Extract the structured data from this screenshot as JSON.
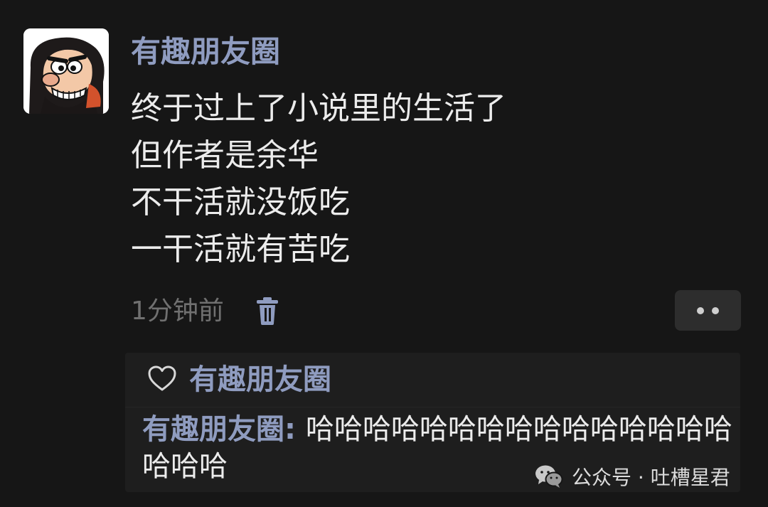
{
  "post": {
    "author": "有趣朋友圈",
    "content_lines": [
      "终于过上了小说里的生活了",
      "但作者是余华",
      "不干活就没饭吃",
      "一干活就有苦吃"
    ],
    "time": "1分钟前"
  },
  "icons": {
    "delete": "trash-icon",
    "more": "more-dots-icon",
    "like": "heart-icon",
    "watermark": "wechat-icon"
  },
  "interactions": {
    "likes": "有趣朋友圈",
    "comment": {
      "author": "有趣朋友圈",
      "separator": ": ",
      "text": "哈哈哈哈哈哈哈哈哈哈哈哈哈哈哈哈哈哈"
    }
  },
  "watermark": {
    "text": "公众号 · 吐槽星君"
  },
  "colors": {
    "background": "#161616",
    "name": "#8f9cc0",
    "text": "#ececec",
    "muted": "#707070",
    "panel": "#1e1e1e"
  }
}
